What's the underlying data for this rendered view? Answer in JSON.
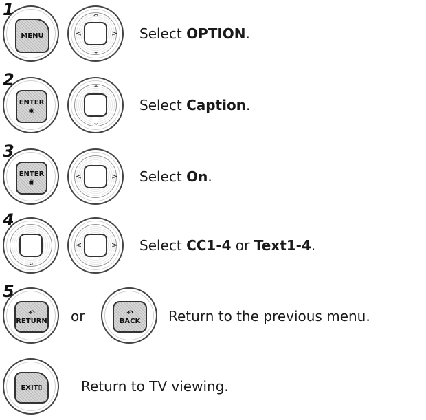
{
  "steps": [
    {
      "number": "1",
      "text_prefix": "Select ",
      "text_bold": "OPTION",
      "text_suffix": "."
    },
    {
      "number": "2",
      "text_prefix": "Select ",
      "text_bold": "Caption",
      "text_suffix": "."
    },
    {
      "number": "3",
      "text_prefix": "Select ",
      "text_bold": "On",
      "text_suffix": "."
    },
    {
      "number": "4",
      "text_prefix": "Select ",
      "text_bold": "CC1-4",
      "text_middle": " or ",
      "text_bold2": "Text1-4",
      "text_suffix": "."
    },
    {
      "number": "5",
      "or_label": "or",
      "text": "Return to the previous menu."
    }
  ],
  "exit_step": {
    "text": "Return to TV viewing."
  },
  "keys": {
    "menu": "MENU",
    "enter": "ENTER",
    "enter_dot": "◉",
    "return": "RETURN",
    "back": "BACK",
    "exit": "EXIT",
    "exit_glyph": "⌷",
    "return_glyph": "↶",
    "back_glyph": "↶"
  },
  "dpad": {
    "up": "^",
    "down": "⌄",
    "left": "<",
    "right": ">"
  }
}
